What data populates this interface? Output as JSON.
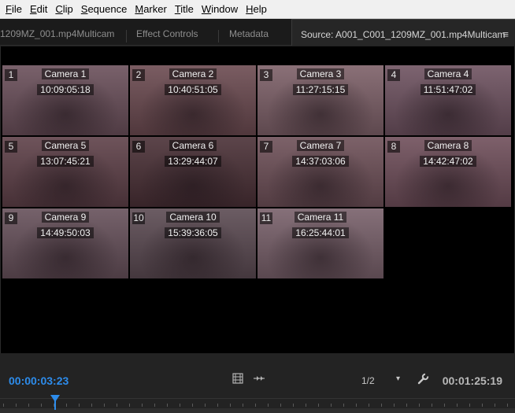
{
  "menu": [
    {
      "key": "F",
      "rest": "ile"
    },
    {
      "key": "E",
      "rest": "dit"
    },
    {
      "key": "C",
      "rest": "lip"
    },
    {
      "key": "S",
      "rest": "equence"
    },
    {
      "key": "M",
      "rest": "arker"
    },
    {
      "key": "T",
      "rest": "itle"
    },
    {
      "key": "W",
      "rest": "indow"
    },
    {
      "key": "H",
      "rest": "elp"
    }
  ],
  "tabs": {
    "tab1": "1209MZ_001.mp4Multicam",
    "tab2": "Effect Controls",
    "tab3": "Metadata",
    "tab4": "Source: A001_C001_1209MZ_001.mp4Multicam",
    "panel_menu": "≡"
  },
  "cameras": [
    {
      "num": "1",
      "name": "Camera 1",
      "tc": "10:09:05:18",
      "color": "#6a4f5a"
    },
    {
      "num": "2",
      "name": "Camera 2",
      "tc": "10:40:51:05",
      "color": "#6b4a50"
    },
    {
      "num": "3",
      "name": "Camera 3",
      "tc": "11:27:15:15",
      "color": "#7d6068"
    },
    {
      "num": "4",
      "name": "Camera 4",
      "tc": "11:51:47:02",
      "color": "#6e5260"
    },
    {
      "num": "5",
      "name": "Camera 5",
      "tc": "13:07:45:21",
      "color": "#5e4048"
    },
    {
      "num": "6",
      "name": "Camera 6",
      "tc": "13:29:44:07",
      "color": "#4a3036"
    },
    {
      "num": "7",
      "name": "Camera 7",
      "tc": "14:37:03:06",
      "color": "#6e5058"
    },
    {
      "num": "8",
      "name": "Camera 8",
      "tc": "14:42:47:02",
      "color": "#6f4e5a"
    },
    {
      "num": "9",
      "name": "Camera 9",
      "tc": "14:49:50:03",
      "color": "#66505a"
    },
    {
      "num": "10",
      "name": "Camera 10",
      "tc": "15:39:36:05",
      "color": "#5b4a52"
    },
    {
      "num": "11",
      "name": "Camera 11",
      "tc": "16:25:44:01",
      "color": "#78606a"
    }
  ],
  "selected_camera": "8",
  "controls": {
    "current_tc": "00:00:03:23",
    "duration_tc": "00:01:25:19",
    "resolution": "1/2",
    "resolution_caret": "▾",
    "icons": [
      "film-strip-icon",
      "play-markers-icon",
      "wrench-icon"
    ]
  }
}
